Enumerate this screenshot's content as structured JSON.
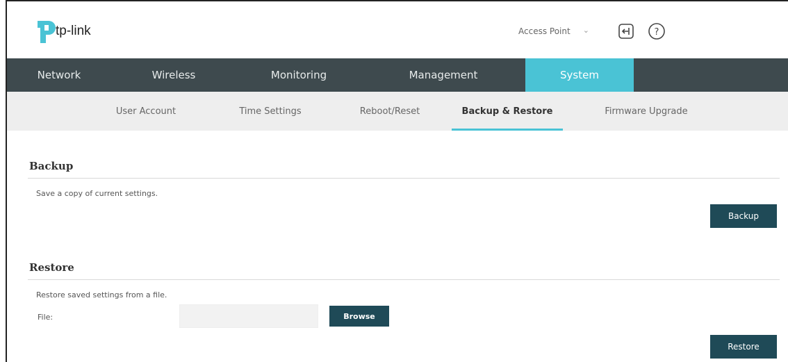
{
  "header": {
    "logo_text": "tp-link",
    "mode_label": "Access Point",
    "icons": [
      "logout-icon",
      "help-icon"
    ]
  },
  "mainnav": {
    "items": [
      {
        "label": "Network"
      },
      {
        "label": "Wireless"
      },
      {
        "label": "Monitoring"
      },
      {
        "label": "Management"
      },
      {
        "label": "System",
        "active": true
      }
    ]
  },
  "subnav": {
    "items": [
      {
        "label": "User Account"
      },
      {
        "label": "Time Settings"
      },
      {
        "label": "Reboot/Reset"
      },
      {
        "label": "Backup & Restore",
        "active": true
      },
      {
        "label": "Firmware Upgrade"
      }
    ]
  },
  "backup": {
    "title": "Backup",
    "description": "Save a copy of current settings.",
    "button_label": "Backup"
  },
  "restore": {
    "title": "Restore",
    "description": "Restore saved settings from a file.",
    "file_label": "File:",
    "file_value": "",
    "browse_label": "Browse",
    "button_label": "Restore"
  },
  "colors": {
    "nav_bg": "#3e4a4e",
    "accent": "#4ac3d5",
    "button_bg": "#1f4a57",
    "subnav_bg": "#eeeeee"
  }
}
